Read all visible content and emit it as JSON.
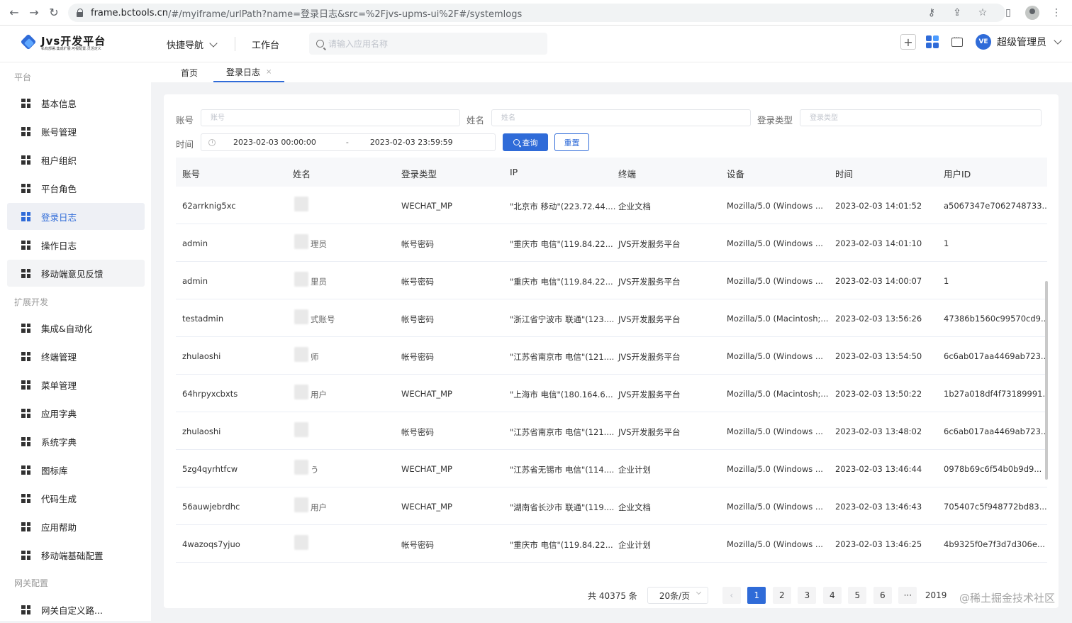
{
  "browser": {
    "url_host": "frame.bctools.cn",
    "url_path": "/#/myiframe/urlPath?name=登录日志&src=%2Fjvs-upms-ui%2F#/systemlogs"
  },
  "header": {
    "logo_title": "Jvs开发平台",
    "logo_subtitle": "私有部署.集成扩展.可视配置.灵活定义",
    "quick_nav": "快捷导航",
    "workbench": "工作台",
    "search_placeholder": "请输入应用名称",
    "plus": "+",
    "avatar_text": "VE",
    "user_name": "超级管理员"
  },
  "sidebar": {
    "groups": [
      "平台",
      "扩展开发",
      "网关配置"
    ],
    "items": [
      {
        "label": "基本信息"
      },
      {
        "label": "账号管理"
      },
      {
        "label": "租户组织"
      },
      {
        "label": "平台角色"
      },
      {
        "label": "登录日志"
      },
      {
        "label": "操作日志"
      },
      {
        "label": "移动端意见反馈"
      },
      {
        "label": "集成&自动化"
      },
      {
        "label": "终端管理"
      },
      {
        "label": "菜单管理"
      },
      {
        "label": "应用字典"
      },
      {
        "label": "系统字典"
      },
      {
        "label": "图标库"
      },
      {
        "label": "代码生成"
      },
      {
        "label": "应用帮助"
      },
      {
        "label": "移动端基础配置"
      },
      {
        "label": "网关自定义路..."
      }
    ],
    "active_index": 4
  },
  "tabs": {
    "home": "首页",
    "active": "登录日志",
    "close": "×"
  },
  "filters": {
    "account_label": "账号",
    "account_placeholder": "账号",
    "name_label": "姓名",
    "name_placeholder": "姓名",
    "login_type_label": "登录类型",
    "login_type_placeholder": "登录类型",
    "time_label": "时间",
    "time_start": "2023-02-03 00:00:00",
    "time_sep": "-",
    "time_end": "2023-02-03 23:59:59",
    "query_button": "查询",
    "reset_button": "重置"
  },
  "table": {
    "columns": [
      "账号",
      "姓名",
      "登录类型",
      "IP",
      "终端",
      "设备",
      "时间",
      "用户ID"
    ],
    "rows": [
      {
        "account": "62arrknig5xc",
        "name_suffix": "",
        "type": "WECHAT_MP",
        "ip": "\"北京市 移动\"(223.72.44....",
        "terminal": "企业文档",
        "device": "Mozilla/5.0 (Windows ...",
        "time": "2023-02-03 14:01:52",
        "uid": "a5067347e7062748733..."
      },
      {
        "account": "admin",
        "name_suffix": "理员",
        "type": "帐号密码",
        "ip": "\"重庆市 电信\"(119.84.22...",
        "terminal": "JVS开发服务平台",
        "device": "Mozilla/5.0 (Windows ...",
        "time": "2023-02-03 14:01:10",
        "uid": "1"
      },
      {
        "account": "admin",
        "name_suffix": "里员",
        "type": "帐号密码",
        "ip": "\"重庆市 电信\"(119.84.22...",
        "terminal": "JVS开发服务平台",
        "device": "Mozilla/5.0 (Windows ...",
        "time": "2023-02-03 14:00:07",
        "uid": "1"
      },
      {
        "account": "testadmin",
        "name_suffix": "式账号",
        "type": "帐号密码",
        "ip": "\"浙江省宁波市 联通\"(123....",
        "terminal": "JVS开发服务平台",
        "device": "Mozilla/5.0 (Macintosh;...",
        "time": "2023-02-03 13:56:26",
        "uid": "47386b1560c99570cd9..."
      },
      {
        "account": "zhulaoshi",
        "name_suffix": "师",
        "type": "帐号密码",
        "ip": "\"江苏省南京市 电信\"(121....",
        "terminal": "JVS开发服务平台",
        "device": "Mozilla/5.0 (Windows ...",
        "time": "2023-02-03 13:54:50",
        "uid": "6c6ab017aa4469ab723..."
      },
      {
        "account": "64hrpyxcbxts",
        "name_suffix": "用户",
        "type": "WECHAT_MP",
        "ip": "\"上海市 电信\"(180.164.6...",
        "terminal": "JVS开发服务平台",
        "device": "Mozilla/5.0 (Macintosh;...",
        "time": "2023-02-03 13:50:22",
        "uid": "1b27a018df4f73189991..."
      },
      {
        "account": "zhulaoshi",
        "name_suffix": "",
        "type": "帐号密码",
        "ip": "\"江苏省南京市 电信\"(121....",
        "terminal": "JVS开发服务平台",
        "device": "Mozilla/5.0 (Windows ...",
        "time": "2023-02-03 13:48:02",
        "uid": "6c6ab017aa4469ab723..."
      },
      {
        "account": "5zg4qyrhtfcw",
        "name_suffix": "う",
        "type": "WECHAT_MP",
        "ip": "\"江苏省无锡市 电信\"(114....",
        "terminal": "企业计划",
        "device": "Mozilla/5.0 (Windows ...",
        "time": "2023-02-03 13:46:44",
        "uid": "0978b69c6f54b0b9d9..."
      },
      {
        "account": "56auwjebrdhc",
        "name_suffix": "用户",
        "type": "WECHAT_MP",
        "ip": "\"湖南省长沙市 联通\"(119....",
        "terminal": "企业文档",
        "device": "Mozilla/5.0 (Windows ...",
        "time": "2023-02-03 13:46:43",
        "uid": "705407c5f948772bd83..."
      },
      {
        "account": "4wazoqs7yjuo",
        "name_suffix": "",
        "type": "帐号密码",
        "ip": "\"重庆市 电信\"(119.84.22...",
        "terminal": "企业计划",
        "device": "Mozilla/5.0 (Windows ...",
        "time": "2023-02-03 13:46:25",
        "uid": "4b9325f0e7f3d7d306e..."
      }
    ]
  },
  "pagination": {
    "total": "共 40375 条",
    "page_size": "20条/页",
    "prev": "‹",
    "pages": [
      "1",
      "2",
      "3",
      "4",
      "5",
      "6"
    ],
    "ellipsis": "···",
    "last": "2019",
    "current": "1"
  },
  "watermark": "@稀土掘金技术社区",
  "colors": {
    "accent": "#2f6bd8",
    "background": "#f2f3f5"
  }
}
